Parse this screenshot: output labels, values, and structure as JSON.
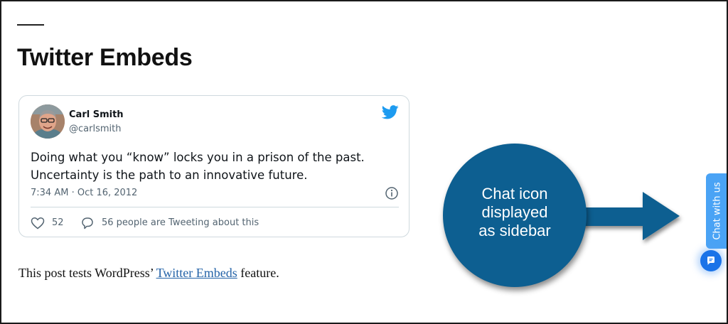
{
  "page": {
    "title": "Twitter Embeds"
  },
  "tweet": {
    "author_name": "Carl Smith",
    "author_handle": "@carlsmith",
    "text_line_1": "Doing what you “know” locks you in a prison of the past.",
    "text_line_2": "Uncertainty is the path to an innovative future.",
    "timestamp": "7:34 AM · Oct 16, 2012",
    "likes_count": "52",
    "tweeting_text": "56 people are Tweeting about this",
    "icons": [
      "avatar",
      "twitter-bird-icon",
      "info-icon",
      "heart-icon",
      "reply-bubble-icon"
    ]
  },
  "post": {
    "text_before": "This post tests WordPress’ ",
    "link_text": "Twitter Embeds",
    "text_after": " feature."
  },
  "annotation": {
    "line_1": "Chat icon",
    "line_2": "displayed",
    "line_3": "as sidebar",
    "circle_color": "#0d5f91"
  },
  "chat_widget": {
    "tab_label": "Chat with us",
    "tab_color": "#4aa3f5",
    "button_color": "#1a73e8",
    "icon": "chat-bubble-icon"
  },
  "colors": {
    "link": "#2463a8",
    "twitter_blue": "#1d9bf0",
    "muted_text": "#536471"
  }
}
